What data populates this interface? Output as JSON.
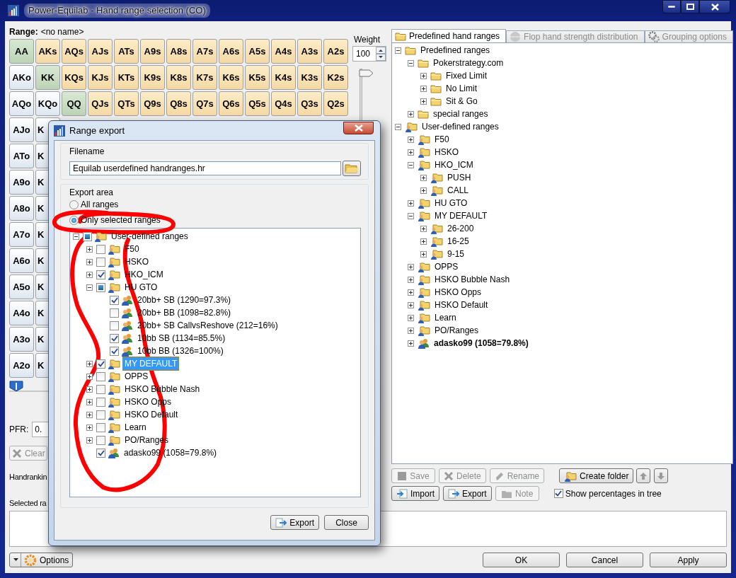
{
  "window": {
    "title": "Power-Equilab - Hand range selection (CO)"
  },
  "range": {
    "label": "Range:",
    "name": "<no name>"
  },
  "grid": {
    "rows": [
      [
        {
          "label": "AA",
          "kind": "pair"
        },
        {
          "label": "AKs",
          "kind": "suited"
        },
        {
          "label": "AQs",
          "kind": "suited"
        },
        {
          "label": "AJs",
          "kind": "suited"
        },
        {
          "label": "ATs",
          "kind": "suited"
        },
        {
          "label": "A9s",
          "kind": "suited"
        },
        {
          "label": "A8s",
          "kind": "suited"
        },
        {
          "label": "A7s",
          "kind": "suited"
        },
        {
          "label": "A6s",
          "kind": "suited"
        },
        {
          "label": "A5s",
          "kind": "suited"
        },
        {
          "label": "A4s",
          "kind": "suited"
        },
        {
          "label": "A3s",
          "kind": "suited"
        },
        {
          "label": "A2s",
          "kind": "suited"
        }
      ],
      [
        {
          "label": "AKo",
          "kind": "offsuit"
        },
        {
          "label": "KK",
          "kind": "pair"
        },
        {
          "label": "KQs",
          "kind": "suited"
        },
        {
          "label": "KJs",
          "kind": "suited"
        },
        {
          "label": "KTs",
          "kind": "suited"
        },
        {
          "label": "K9s",
          "kind": "suited"
        },
        {
          "label": "K8s",
          "kind": "suited"
        },
        {
          "label": "K7s",
          "kind": "suited"
        },
        {
          "label": "K6s",
          "kind": "suited"
        },
        {
          "label": "K5s",
          "kind": "suited"
        },
        {
          "label": "K4s",
          "kind": "suited"
        },
        {
          "label": "K3s",
          "kind": "suited"
        },
        {
          "label": "K2s",
          "kind": "suited"
        }
      ],
      [
        {
          "label": "AQo",
          "kind": "offsuit"
        },
        {
          "label": "KQo",
          "kind": "offsuit"
        },
        {
          "label": "QQ",
          "kind": "pair"
        },
        {
          "label": "QJs",
          "kind": "suited"
        },
        {
          "label": "QTs",
          "kind": "suited"
        },
        {
          "label": "Q9s",
          "kind": "suited"
        },
        {
          "label": "Q8s",
          "kind": "suited"
        },
        {
          "label": "Q7s",
          "kind": "suited"
        },
        {
          "label": "Q6s",
          "kind": "suited"
        },
        {
          "label": "Q5s",
          "kind": "suited"
        },
        {
          "label": "Q4s",
          "kind": "suited"
        },
        {
          "label": "Q3s",
          "kind": "suited"
        },
        {
          "label": "Q2s",
          "kind": "suited"
        }
      ],
      [
        {
          "label": "AJo",
          "kind": "offsuit"
        },
        {
          "label": "K",
          "kind": "offsuit"
        }
      ],
      [
        {
          "label": "ATo",
          "kind": "offsuit"
        },
        {
          "label": "K",
          "kind": "offsuit"
        }
      ],
      [
        {
          "label": "A9o",
          "kind": "offsuit"
        },
        {
          "label": "K",
          "kind": "offsuit"
        }
      ],
      [
        {
          "label": "A8o",
          "kind": "offsuit"
        },
        {
          "label": "K",
          "kind": "offsuit"
        }
      ],
      [
        {
          "label": "A7o",
          "kind": "offsuit"
        },
        {
          "label": "K",
          "kind": "offsuit"
        }
      ],
      [
        {
          "label": "A6o",
          "kind": "offsuit"
        },
        {
          "label": "K",
          "kind": "offsuit"
        }
      ],
      [
        {
          "label": "A5o",
          "kind": "offsuit"
        },
        {
          "label": "K",
          "kind": "offsuit"
        }
      ],
      [
        {
          "label": "A4o",
          "kind": "offsuit"
        },
        {
          "label": "K",
          "kind": "offsuit"
        }
      ],
      [
        {
          "label": "A3o",
          "kind": "offsuit"
        },
        {
          "label": "K",
          "kind": "offsuit"
        }
      ],
      [
        {
          "label": "A2o",
          "kind": "offsuit"
        },
        {
          "label": "K",
          "kind": "offsuit"
        }
      ]
    ]
  },
  "weight": {
    "label": "Weight",
    "value": "100",
    "level": 1
  },
  "range_slider": {
    "level": 0
  },
  "pfr": {
    "label": "PFR:",
    "value": "0."
  },
  "clear_button": {
    "label": "Clear",
    "disabled": true
  },
  "handranking_label": "Handrankin",
  "selected_range_label": "Selected ra",
  "tabs": [
    {
      "label": "Predefined hand ranges",
      "selected": true,
      "disabled": false
    },
    {
      "label": "Flop hand strength distribution",
      "selected": false,
      "disabled": true
    },
    {
      "label": "Grouping options",
      "selected": false,
      "disabled": true
    }
  ],
  "tree": [
    {
      "label": "Predefined ranges",
      "kind": "folder",
      "expanded": true,
      "children": [
        {
          "label": "Pokerstrategy.com",
          "kind": "folder",
          "expanded": true,
          "children": [
            {
              "label": "Fixed Limit",
              "kind": "folder",
              "expanded": false
            },
            {
              "label": "No Limit",
              "kind": "folder",
              "expanded": false
            },
            {
              "label": "Sit & Go",
              "kind": "folder",
              "expanded": false
            }
          ]
        },
        {
          "label": "special ranges",
          "kind": "folder",
          "expanded": false
        }
      ]
    },
    {
      "label": "User-defined ranges",
      "kind": "user-folder",
      "expanded": true,
      "children": [
        {
          "label": "F50",
          "kind": "user-folder",
          "expanded": false
        },
        {
          "label": "HSKO",
          "kind": "user-folder",
          "expanded": false
        },
        {
          "label": "HKO_ICM",
          "kind": "user-folder",
          "expanded": true,
          "children": [
            {
              "label": "PUSH",
              "kind": "user-folder",
              "expanded": false
            },
            {
              "label": "CALL",
              "kind": "user-folder",
              "expanded": false
            }
          ]
        },
        {
          "label": "HU GTO",
          "kind": "user-folder",
          "expanded": false
        },
        {
          "label": "MY DEFAULT",
          "kind": "user-folder",
          "expanded": true,
          "children": [
            {
              "label": "26-200",
              "kind": "user-folder",
              "expanded": false
            },
            {
              "label": "16-25",
              "kind": "user-folder",
              "expanded": false
            },
            {
              "label": "9-15",
              "kind": "user-folder",
              "expanded": false
            }
          ]
        },
        {
          "label": "OPPS",
          "kind": "user-folder",
          "expanded": false
        },
        {
          "label": "HSKO Bubble Nash",
          "kind": "user-folder",
          "expanded": false
        },
        {
          "label": "HSKO Opps",
          "kind": "user-folder",
          "expanded": false
        },
        {
          "label": "HSKO Default",
          "kind": "user-folder",
          "expanded": false
        },
        {
          "label": "Learn",
          "kind": "user-folder",
          "expanded": false
        },
        {
          "label": "PO/Ranges",
          "kind": "user-folder",
          "expanded": false
        },
        {
          "label": "adasko99 (1058=79.8%)",
          "kind": "range",
          "expanded": false,
          "current": true
        }
      ]
    }
  ],
  "tree_buttons": [
    [
      {
        "label": "Save",
        "disabled": true
      },
      {
        "label": "Delete",
        "disabled": true
      },
      {
        "label": "Rename",
        "disabled": true
      },
      {
        "label": "Create folder",
        "disabled": false
      },
      {
        "kind": "up",
        "disabled": false
      },
      {
        "kind": "down",
        "disabled": false
      }
    ],
    [
      {
        "label": "Import",
        "disabled": false
      },
      {
        "label": "Export",
        "disabled": false
      },
      {
        "label": "Note",
        "disabled": true
      }
    ]
  ],
  "show_percentages": {
    "label": "Show percentages in tree",
    "checked": true
  },
  "footer": {
    "options": "Options",
    "buttons": [
      "OK",
      "Cancel",
      "Apply"
    ]
  },
  "dialog": {
    "title": "Range export",
    "filename": {
      "label": "Filename",
      "value": "Equilab userdefined handranges.hr"
    },
    "export_area": {
      "label": "Export area",
      "options": [
        {
          "label": "All ranges",
          "selected": false
        },
        {
          "label": "Only selected ranges",
          "selected": true
        }
      ]
    },
    "tree": [
      {
        "label": "User-defined ranges",
        "kind": "user-folder",
        "expanded": true,
        "checked": false,
        "partial": true,
        "selected": false,
        "children": [
          {
            "label": "F50",
            "kind": "user-folder",
            "expanded": false,
            "checked": false,
            "selected": false
          },
          {
            "label": "HSKO",
            "kind": "user-folder",
            "expanded": false,
            "checked": false,
            "selected": false
          },
          {
            "label": "HKO_ICM",
            "kind": "user-folder",
            "expanded": false,
            "checked": true,
            "selected": false
          },
          {
            "label": "HU GTO",
            "kind": "user-folder",
            "expanded": true,
            "checked": false,
            "partial": true,
            "selected": false,
            "children": [
              {
                "label": "20bb+ SB (1290=97.3%)",
                "kind": "range",
                "checked": true,
                "selected": false
              },
              {
                "label": "20bb+ BB (1098=82.8%)",
                "kind": "range",
                "checked": false,
                "selected": false
              },
              {
                "label": "20bb+ SB CallvsReshove (212=16%)",
                "kind": "range",
                "checked": false,
                "selected": false
              },
              {
                "label": "10bb SB (1134=85.5%)",
                "kind": "range",
                "checked": true,
                "selected": false
              },
              {
                "label": "10bb BB (1326=100%)",
                "kind": "range",
                "checked": true,
                "selected": false
              }
            ]
          },
          {
            "label": "MY DEFAULT",
            "kind": "user-folder",
            "expanded": false,
            "checked": true,
            "selected": true
          },
          {
            "label": "OPPS",
            "kind": "user-folder",
            "expanded": false,
            "checked": false,
            "selected": false
          },
          {
            "label": "HSKO Bubble Nash",
            "kind": "user-folder",
            "expanded": false,
            "checked": false,
            "selected": false
          },
          {
            "label": "HSKO Opps",
            "kind": "user-folder",
            "expanded": false,
            "checked": false,
            "selected": false
          },
          {
            "label": "HSKO Default",
            "kind": "user-folder",
            "expanded": false,
            "checked": false,
            "selected": false
          },
          {
            "label": "Learn",
            "kind": "user-folder",
            "expanded": false,
            "checked": false,
            "selected": false
          },
          {
            "label": "PO/Ranges",
            "kind": "user-folder",
            "expanded": false,
            "checked": false,
            "selected": false
          },
          {
            "label": "adasko99 (1058=79.8%)",
            "kind": "range",
            "checked": true,
            "selected": false
          }
        ]
      }
    ],
    "buttons": [
      {
        "label": "Export"
      },
      {
        "label": "Close"
      }
    ]
  }
}
